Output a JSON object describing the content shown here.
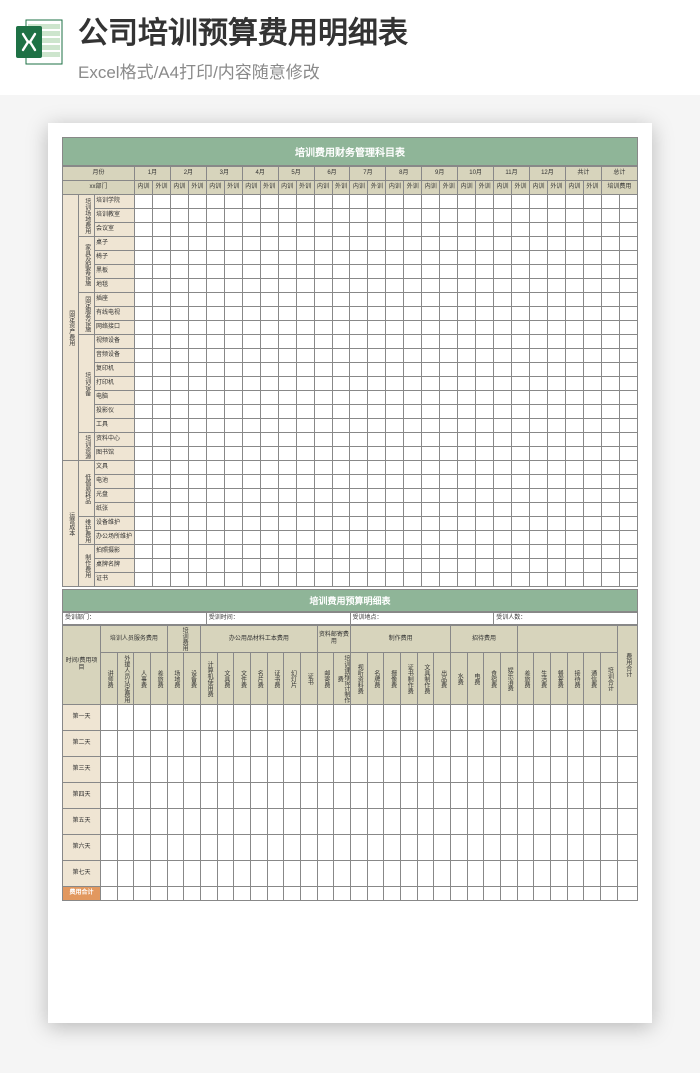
{
  "header": {
    "title": "公司培训预算费用明细表",
    "subtitle": "Excel格式/A4打印/内容随意修改"
  },
  "table1": {
    "title": "培训费用财务管理科目表",
    "month_label": "月份",
    "dept_label": "xx部门",
    "months": [
      "1月",
      "2月",
      "3月",
      "4月",
      "5月",
      "6月",
      "7月",
      "8月",
      "9月",
      "10月",
      "11月",
      "12月",
      "共计",
      "总计"
    ],
    "sub_cols": [
      "内训",
      "外训"
    ],
    "last_header": "培训费用",
    "groups": [
      {
        "cat": "固定资产费用",
        "sub": "培训场地费用",
        "items": [
          "培训学院",
          "培训教室",
          "会议室"
        ]
      },
      {
        "cat": "",
        "sub": "家具及配套设施",
        "items": [
          "桌子",
          "椅子",
          "黑板",
          "地毯"
        ]
      },
      {
        "cat": "",
        "sub": "固定服务设施",
        "items": [
          "插座",
          "有线电视",
          "网络接口"
        ]
      },
      {
        "cat": "",
        "sub": "培训设备",
        "items": [
          "视频设备",
          "音频设备",
          "复印机",
          "打印机",
          "电脑",
          "投影仪",
          "工具"
        ]
      },
      {
        "cat": "",
        "sub": "培训资源",
        "items": [
          "资料中心",
          "图书馆"
        ]
      },
      {
        "cat": "运营成本",
        "sub": "低值易耗品",
        "items": [
          "文具",
          "电池",
          "光盘",
          "纸张"
        ]
      },
      {
        "cat": "",
        "sub": "维护费用",
        "items": [
          "设备维护",
          "办公场所维护"
        ]
      },
      {
        "cat": "",
        "sub": "制作费用",
        "items": [
          "拍照摄影",
          "桌牌名牌",
          "证书"
        ]
      }
    ]
  },
  "table2": {
    "title": "培训费用预算明细表",
    "meta": {
      "c1": "受训部门：",
      "c2": "受训时间：",
      "c3": "受训地点：",
      "c4": "受训人数："
    },
    "row_head": "时间/费用项目",
    "cat_headers": [
      "培训人员服务费用",
      "培训费用",
      "办公用品材料工本费用",
      "资料邮寄费用",
      "制作费用",
      "招待费用",
      ""
    ],
    "sub_headers": [
      "讲师费",
      "外援人员认定费用",
      "人事费",
      "差旅费",
      "场地费",
      "设备费",
      "计算机使用费",
      "文具费",
      "文件费",
      "名片费",
      "证书费",
      "幻灯片",
      "证书",
      "邮寄费",
      "培训课程设计制作费",
      "视听资料费",
      "名牌费",
      "摄像费",
      "证书制作费",
      "文具制作费",
      "出品费",
      "水费",
      "电费",
      "食宿费",
      "娱乐消费",
      "差旅费",
      "生活费",
      "餐宴费",
      "接待费",
      "通信费",
      "培训合计"
    ],
    "total_col": "费用合计",
    "days": [
      "第一天",
      "第二天",
      "第三天",
      "第四天",
      "第五天",
      "第六天",
      "第七天"
    ],
    "total_row": "费用合计"
  },
  "chart_data": {
    "type": "table",
    "note": "Template spreadsheet; all data cells are empty in the source image."
  }
}
